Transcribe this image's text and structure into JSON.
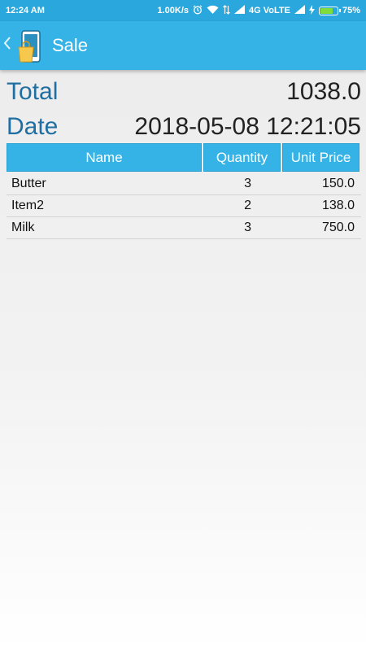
{
  "status_bar": {
    "time": "12:24 AM",
    "net_speed": "1.00K/s",
    "network": "4G VoLTE",
    "battery": "75%",
    "battery_level": 0.75,
    "battery_color": "#7fdc3a"
  },
  "app_bar": {
    "title": "Sale",
    "color": "#35b3e6"
  },
  "summary": {
    "total_label": "Total",
    "total_value": "1038.0",
    "date_label": "Date",
    "date_value": "2018-05-08 12:21:05"
  },
  "table": {
    "headers": {
      "name": "Name",
      "quantity": "Quantity",
      "unit_price": "Unit Price"
    },
    "rows": [
      {
        "name": "Butter",
        "quantity": "3",
        "unit_price": "150.0"
      },
      {
        "name": "Item2",
        "quantity": "2",
        "unit_price": "138.0"
      },
      {
        "name": "Milk",
        "quantity": "3",
        "unit_price": "750.0"
      }
    ]
  }
}
